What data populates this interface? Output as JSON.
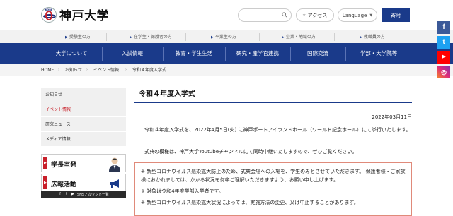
{
  "header": {
    "logo_text": "神戸大学",
    "logo_mark_text": "KOBE",
    "access_label": "アクセス",
    "language_label": "Language",
    "donate_label": "寄附"
  },
  "subnav": {
    "items": [
      "受験生の方",
      "在学生・保護者の方",
      "卒業生の方",
      "企業・地域の方",
      "教職員の方"
    ]
  },
  "mainnav": {
    "items": [
      "大学について",
      "入試情報",
      "教育・学生生活",
      "研究・産学官連携",
      "国際交流",
      "学部・大学院等"
    ]
  },
  "breadcrumb": {
    "items": [
      "HOME",
      "お知らせ",
      "イベント情報",
      "令和４年度入学式"
    ]
  },
  "sidebar": {
    "items": [
      "お知らせ",
      "イベント情報",
      "研究ニュース",
      "メディア情報"
    ],
    "banner1": "学長室発",
    "banner2": "広報活動",
    "sns_label": "SNSアカウント一覧"
  },
  "content": {
    "title": "令和４年度入学式",
    "date": "2022年03月11日",
    "para1": "令和４年度入学式を、2022年4月5日(火) に神戸ポートアイランドホール（ワールド記念ホール）にて挙行いたします。",
    "para2": "式典の模様は、神戸大学Youtubeチャンネルにて同時中継いたしますので、ぜひご覧ください。",
    "notice1_a": "※ 新型コロナウイルス感染拡大防止のため、",
    "notice1_u": "式典会場への入場を、学生のみ",
    "notice1_b": "とさせていただきます。 保護者様・ご家族様におかれましては、かかる状況を何卒ご理解いただきますよう、お願い申し上げます。",
    "notice2": "※ 対象は令和4年度学部入学者です。",
    "notice3": "※ 新型コロナウイルス感染拡大状況によっては、実施方法の変更、又は中止することがあります。"
  },
  "social": {
    "facebook": "f",
    "twitter": "t",
    "youtube": "▶",
    "instagram": "◎"
  },
  "colors": {
    "primary": "#1a3a8a",
    "accent": "#c8202a"
  }
}
